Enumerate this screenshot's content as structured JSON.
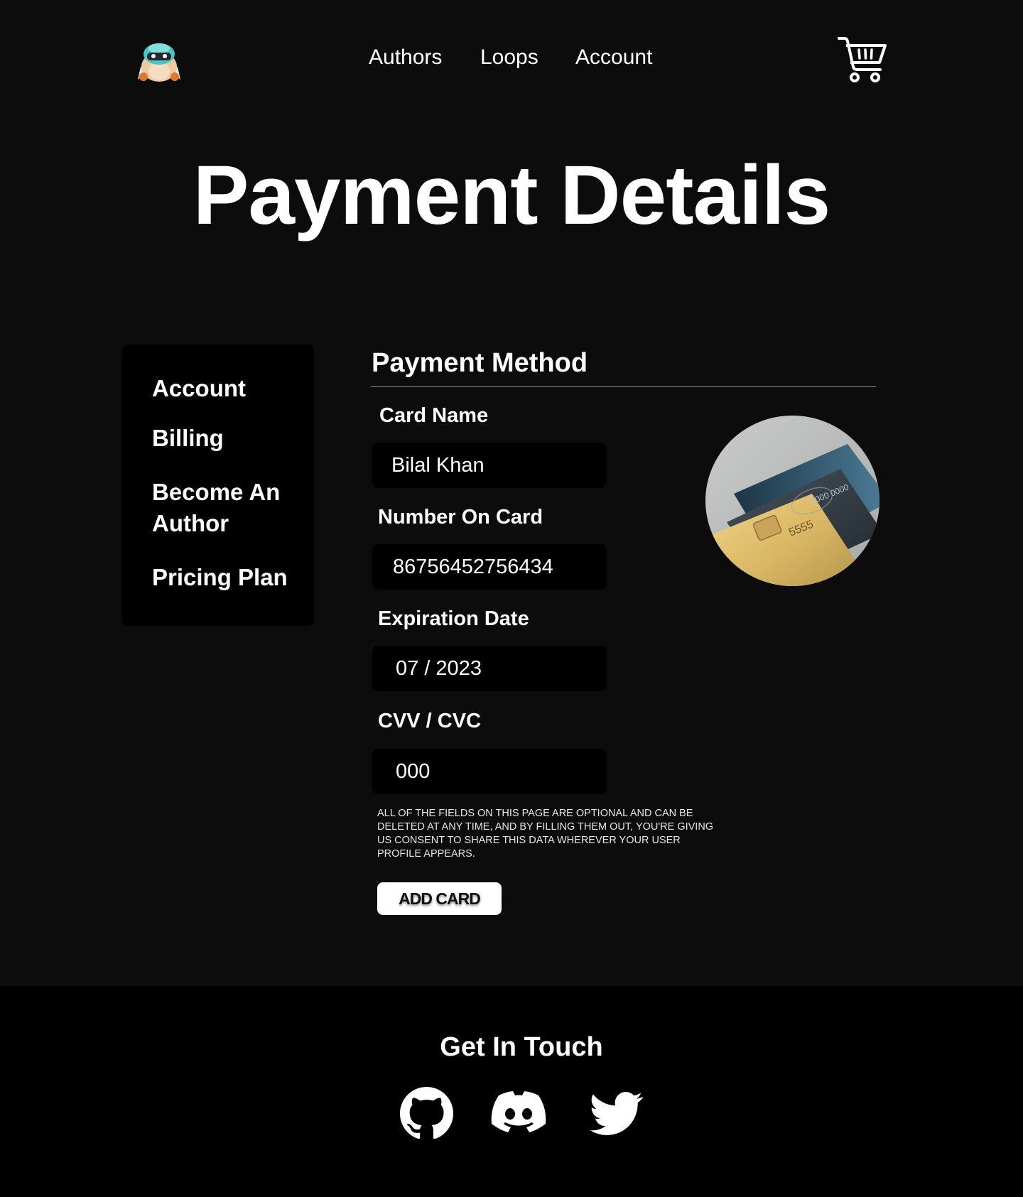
{
  "header": {
    "logo": "mascot-logo",
    "nav": [
      {
        "label": "Authors"
      },
      {
        "label": "Loops"
      },
      {
        "label": "Account"
      }
    ],
    "cart_icon": "cart-icon"
  },
  "page": {
    "title": "Payment Details"
  },
  "sidebar": {
    "items": [
      {
        "label": "Account"
      },
      {
        "label": "Billing"
      },
      {
        "label": "Become An Author"
      },
      {
        "label": "Pricing Plan"
      }
    ]
  },
  "payment": {
    "section_title": "Payment Method",
    "fields": {
      "card_name": {
        "label": "Card Name",
        "value": "Bilal Khan"
      },
      "card_number": {
        "label": "Number On Card",
        "value": "86756452756434"
      },
      "expiration": {
        "label": "Expiration Date",
        "value": "07 / 2023"
      },
      "cvv": {
        "label": "CVV / CVC",
        "value": "000"
      }
    },
    "disclaimer": "ALL OF THE FIELDS ON THIS PAGE ARE OPTIONAL AND CAN BE DELETED AT ANY TIME, AND BY FILLING THEM OUT, YOU'RE GIVING US CONSENT TO SHARE THIS DATA WHEREVER YOUR USER PROFILE APPEARS.",
    "add_card_label": "ADD CARD",
    "card_image": "credit-cards-photo"
  },
  "footer": {
    "title": "Get In Touch",
    "socials": [
      {
        "icon": "github-icon"
      },
      {
        "icon": "discord-icon"
      },
      {
        "icon": "twitter-icon"
      }
    ]
  },
  "colors": {
    "background": "#0c0c0c",
    "panel": "#000000",
    "text": "#ffffff",
    "button": "#ffffff"
  }
}
